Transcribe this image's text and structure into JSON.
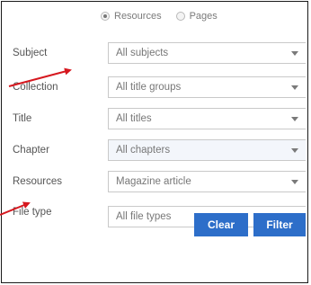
{
  "search_type": {
    "options": [
      {
        "label": "Resources",
        "selected": true
      },
      {
        "label": "Pages",
        "selected": false
      }
    ]
  },
  "filters": [
    {
      "label": "Subject",
      "value": "All subjects"
    },
    {
      "label": "Collection",
      "value": "All title groups"
    },
    {
      "label": "Title",
      "value": "All titles"
    },
    {
      "label": "Chapter",
      "value": "All chapters"
    },
    {
      "label": "Resources",
      "value": "Magazine article"
    },
    {
      "label": "File type",
      "value": "All file types"
    }
  ],
  "buttons": {
    "clear": "Clear",
    "filter": "Filter"
  },
  "colors": {
    "button": "#2d6ec9",
    "annotation_arrow": "#d6181f"
  }
}
